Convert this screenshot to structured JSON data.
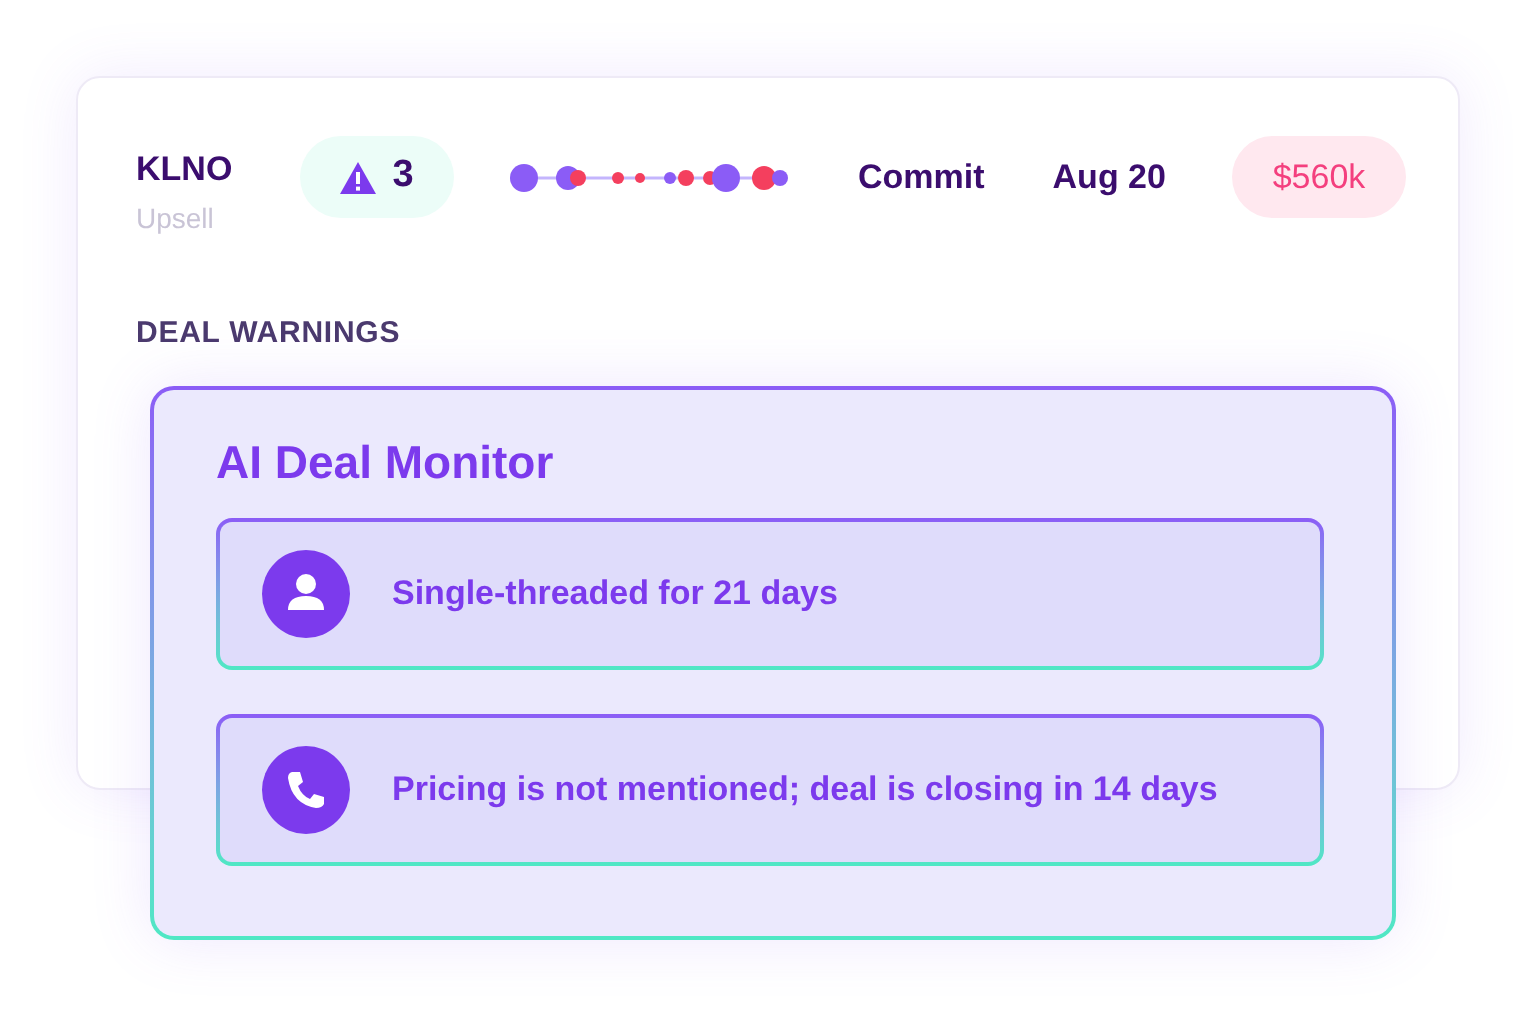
{
  "deal": {
    "name": "KLNO",
    "type": "Upsell",
    "warning_count": "3",
    "forecast": "Commit",
    "close_date": "Aug 20",
    "amount": "$560k"
  },
  "section_title": "DEAL WARNINGS",
  "monitor": {
    "title": "AI Deal Monitor",
    "warnings": [
      {
        "kind": "person",
        "text": "Single-threaded for 21 days"
      },
      {
        "kind": "phone",
        "text": "Pricing is not mentioned; deal is closing in 14 days"
      }
    ]
  }
}
